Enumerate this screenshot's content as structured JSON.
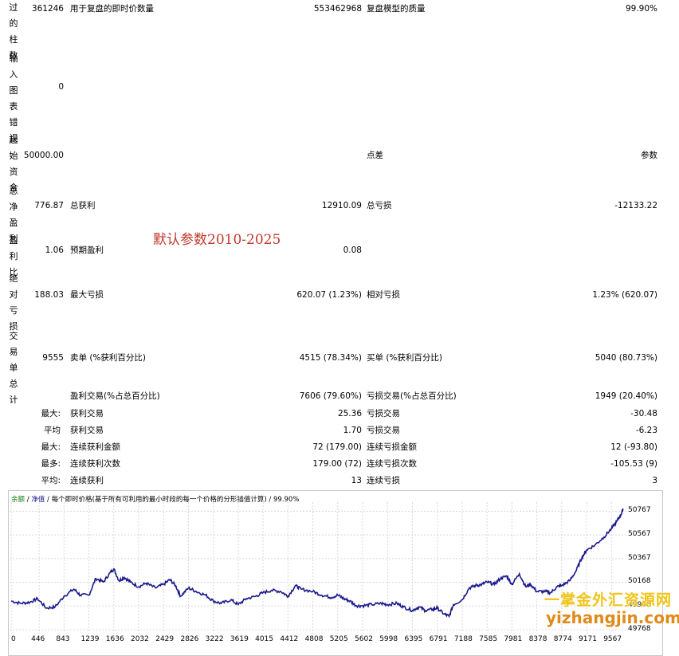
{
  "left_labels": {
    "l1": "过的柱数",
    "l2": "输入图表错误",
    "l3": "起始资金",
    "l4": "总净盈利",
    "l5": "盈利比",
    "l6": "绝对亏损",
    "l7": "交易单总计"
  },
  "stats": {
    "bars": "361246",
    "ticks_label": "用于复盘的即时价数量",
    "ticks": "553462968",
    "quality_label": "复盘模型的质量",
    "quality": "99.90%",
    "errors": "0",
    "deposit": "50000.00",
    "spread_label": "点差",
    "spread": "参数",
    "net_profit": "776.87",
    "gross_profit_label": "总获利",
    "gross_profit": "12910.09",
    "gross_loss_label": "总亏损",
    "gross_loss": "-12133.22",
    "profit_factor": "1.06",
    "expected_label": "预期盈利",
    "expected": "0.08",
    "abs_dd": "188.03",
    "max_dd_label": "最大亏损",
    "max_dd": "620.07 (1.23%)",
    "rel_dd_label": "相对亏损",
    "rel_dd": "1.23% (620.07)",
    "total_trades": "9555",
    "short_label": "卖单 (%获利百分比)",
    "short": "4515 (78.34%)",
    "long_label": "买单 (%获利百分比)",
    "long": "5040 (80.73%)",
    "profit_trades_label": "盈利交易(%占总百分比)",
    "profit_trades": "7606 (79.60%)",
    "loss_trades_label": "亏损交易(%占总百分比)",
    "loss_trades": "1949 (20.40%)"
  },
  "rows": [
    {
      "prefix": "最大:",
      "l1": "获利交易",
      "v1": "25.36",
      "l2": "亏损交易",
      "v2": "-30.48"
    },
    {
      "prefix": "平均",
      "l1": "获利交易",
      "v1": "1.70",
      "l2": "亏损交易",
      "v2": "-6.23"
    },
    {
      "prefix": "最大:",
      "l1": "连续获利金额",
      "v1": "72 (179.00)",
      "l2": "连续亏损金额",
      "v2": "12 (-93.80)"
    },
    {
      "prefix": "最多:",
      "l1": "连续获利次数",
      "v1": "179.00 (72)",
      "l2": "连续亏损次数",
      "v2": "-105.53 (9)"
    },
    {
      "prefix": "平均:",
      "l1": "连续获利",
      "v1": "13",
      "l2": "连续亏损",
      "v2": "3"
    }
  ],
  "annotation": "默认参数2010-2025",
  "chart_legend": {
    "balance": "余额",
    "sep1": " / ",
    "equity": "净值",
    "rest": " / 每个即时价格(基于所有可利用的最小时段的每一个价格的分形插值计算) / 99.90%"
  },
  "chart_data": {
    "type": "line",
    "x_ticks": [
      "0",
      "446",
      "843",
      "1239",
      "1636",
      "2032",
      "2429",
      "2826",
      "3222",
      "3619",
      "4015",
      "4412",
      "4808",
      "5205",
      "5602",
      "5998",
      "6395",
      "6791",
      "7188",
      "7585",
      "7981",
      "8378",
      "8774",
      "9171",
      "9567"
    ],
    "y_ticks": [
      "50767",
      "50567",
      "50367",
      "50168",
      "49968",
      "49768"
    ],
    "ylim": [
      49768,
      50830
    ],
    "xlim": [
      0,
      9755
    ],
    "series": [
      {
        "color": "#1a1a8c",
        "points": [
          [
            0,
            50010
          ],
          [
            150,
            49990
          ],
          [
            300,
            50000
          ],
          [
            420,
            50030
          ],
          [
            560,
            49950
          ],
          [
            700,
            49960
          ],
          [
            843,
            50050
          ],
          [
            1000,
            50110
          ],
          [
            1100,
            50060
          ],
          [
            1239,
            50060
          ],
          [
            1350,
            50200
          ],
          [
            1470,
            50170
          ],
          [
            1580,
            50250
          ],
          [
            1636,
            50280
          ],
          [
            1720,
            50180
          ],
          [
            1800,
            50210
          ],
          [
            1900,
            50170
          ],
          [
            2032,
            50130
          ],
          [
            2150,
            50160
          ],
          [
            2300,
            50120
          ],
          [
            2429,
            50150
          ],
          [
            2530,
            50190
          ],
          [
            2620,
            50140
          ],
          [
            2700,
            50050
          ],
          [
            2826,
            50120
          ],
          [
            2950,
            50090
          ],
          [
            3100,
            50060
          ],
          [
            3222,
            50010
          ],
          [
            3350,
            49990
          ],
          [
            3500,
            50020
          ],
          [
            3619,
            49980
          ],
          [
            3750,
            50030
          ],
          [
            3900,
            50050
          ],
          [
            4015,
            50080
          ],
          [
            4150,
            50100
          ],
          [
            4300,
            50090
          ],
          [
            4412,
            50050
          ],
          [
            4530,
            50140
          ],
          [
            4620,
            50110
          ],
          [
            4808,
            50090
          ],
          [
            4950,
            50060
          ],
          [
            5100,
            50040
          ],
          [
            5205,
            50060
          ],
          [
            5300,
            50030
          ],
          [
            5400,
            50010
          ],
          [
            5500,
            49970
          ],
          [
            5602,
            49970
          ],
          [
            5750,
            49980
          ],
          [
            5900,
            49990
          ],
          [
            5998,
            49980
          ],
          [
            6150,
            49990
          ],
          [
            6250,
            49960
          ],
          [
            6395,
            49930
          ],
          [
            6500,
            49960
          ],
          [
            6600,
            49930
          ],
          [
            6720,
            49940
          ],
          [
            6791,
            49950
          ],
          [
            6900,
            49900
          ],
          [
            6980,
            49880
          ],
          [
            7050,
            49980
          ],
          [
            7188,
            50020
          ],
          [
            7300,
            50120
          ],
          [
            7400,
            50140
          ],
          [
            7500,
            50150
          ],
          [
            7585,
            50170
          ],
          [
            7700,
            50150
          ],
          [
            7800,
            50200
          ],
          [
            7900,
            50220
          ],
          [
            7981,
            50150
          ],
          [
            8100,
            50240
          ],
          [
            8200,
            50130
          ],
          [
            8280,
            50150
          ],
          [
            8378,
            50090
          ],
          [
            8500,
            50090
          ],
          [
            8600,
            50080
          ],
          [
            8700,
            50130
          ],
          [
            8774,
            50140
          ],
          [
            8900,
            50180
          ],
          [
            9000,
            50260
          ],
          [
            9100,
            50380
          ],
          [
            9171,
            50440
          ],
          [
            9300,
            50480
          ],
          [
            9450,
            50550
          ],
          [
            9567,
            50620
          ],
          [
            9650,
            50680
          ],
          [
            9720,
            50740
          ],
          [
            9755,
            50790
          ]
        ]
      }
    ]
  },
  "watermark": {
    "line1": "一掌金外汇资源网",
    "line2": "yizhangjin.com"
  }
}
